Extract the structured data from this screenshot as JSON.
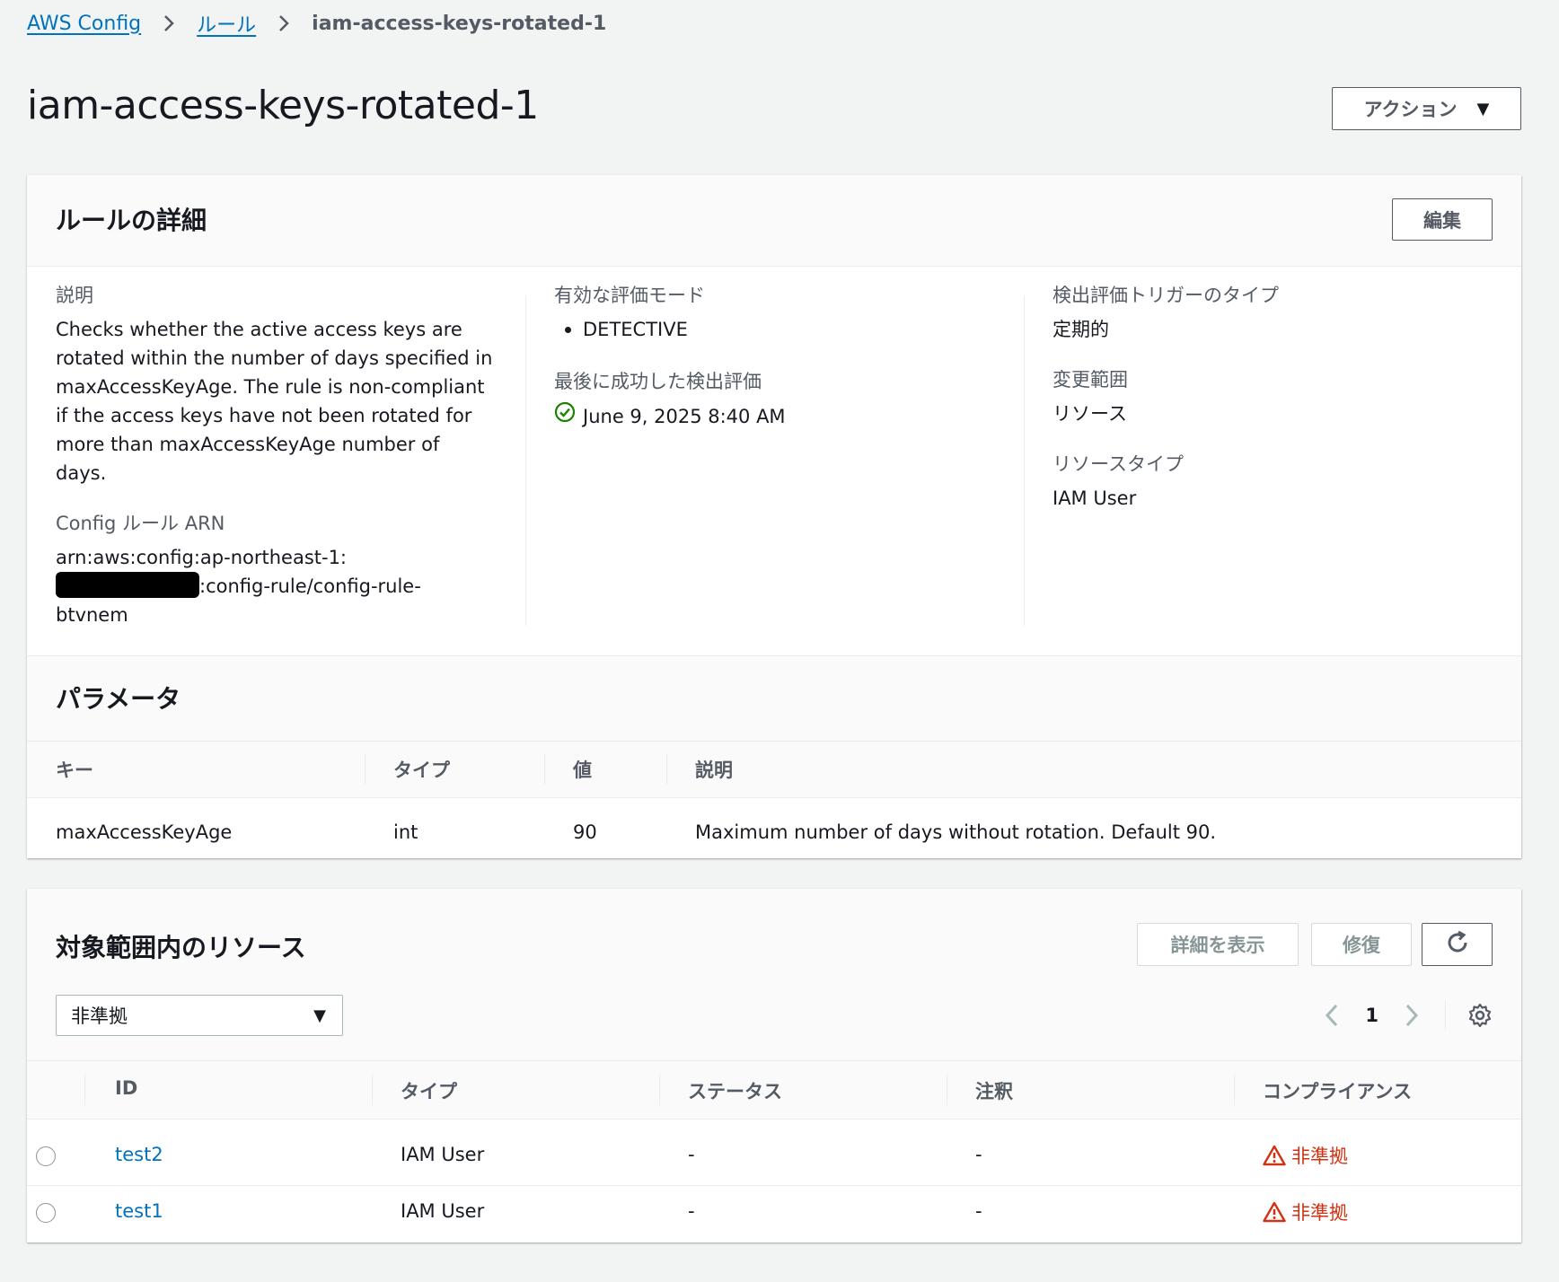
{
  "breadcrumb": {
    "items": [
      "AWS Config",
      "ルール"
    ],
    "current": "iam-access-keys-rotated-1"
  },
  "page": {
    "title": "iam-access-keys-rotated-1",
    "action_label": "アクション"
  },
  "rule_details": {
    "heading": "ルールの詳細",
    "edit_label": "編集",
    "description_label": "説明",
    "description": "Checks whether the active access keys are rotated within the number of days specified in maxAccessKeyAge. The rule is non-compliant if the access keys have not been rotated for more than maxAccessKeyAge number of days.",
    "arn_label": "Config ルール ARN",
    "arn_prefix": "arn:aws:config:ap-northeast-1:",
    "arn_suffix": ":config-rule/config-rule-btvnem",
    "eval_mode_label": "有効な評価モード",
    "eval_modes": [
      "DETECTIVE"
    ],
    "last_success_label": "最後に成功した検出評価",
    "last_success": "June 9, 2025 8:40 AM",
    "trigger_type_label": "検出評価トリガーのタイプ",
    "trigger_type": "定期的",
    "scope_label": "変更範囲",
    "scope": "リソース",
    "resource_type_label": "リソースタイプ",
    "resource_type": "IAM User"
  },
  "parameters": {
    "heading": "パラメータ",
    "columns": [
      "キー",
      "タイプ",
      "値",
      "説明"
    ],
    "rows": [
      {
        "key": "maxAccessKeyAge",
        "type": "int",
        "value": "90",
        "description": "Maximum number of days without rotation. Default 90."
      }
    ]
  },
  "resources": {
    "heading": "対象範囲内のリソース",
    "details_label": "詳細を表示",
    "remediate_label": "修復",
    "refresh_icon": "refresh-icon",
    "filter_value": "非準拠",
    "page_number": "1",
    "columns": [
      "ID",
      "タイプ",
      "ステータス",
      "注釈",
      "コンプライアンス"
    ],
    "rows": [
      {
        "id": "test2",
        "type": "IAM User",
        "status": "-",
        "annotation": "-",
        "compliance": "非準拠"
      },
      {
        "id": "test1",
        "type": "IAM User",
        "status": "-",
        "annotation": "-",
        "compliance": "非準拠"
      }
    ]
  },
  "colors": {
    "link": "#0073bb",
    "success": "#1d8102",
    "error": "#d13212",
    "background": "#f2f3f3"
  }
}
